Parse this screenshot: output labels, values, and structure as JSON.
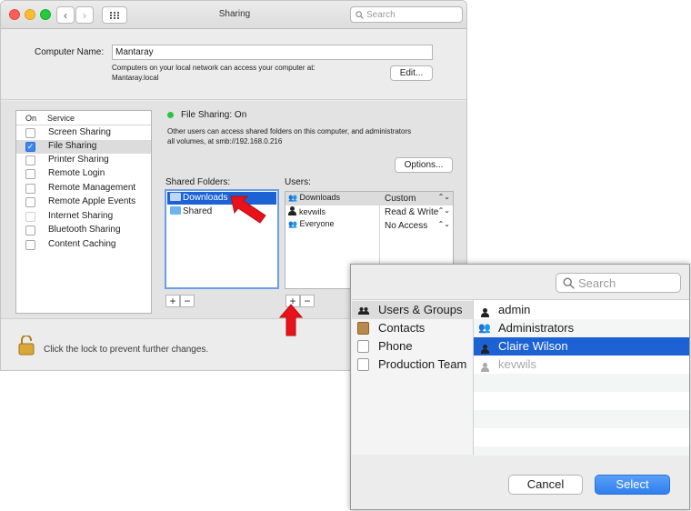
{
  "window": {
    "title": "Sharing",
    "search_placeholder": "Search",
    "computer_name_label": "Computer Name:",
    "computer_name_value": "Mantaray",
    "network_note_1": "Computers on your local network can access your computer at:",
    "network_note_2": "Mantaray.local",
    "edit_button": "Edit...",
    "services": {
      "col_on": "On",
      "col_service": "Service",
      "items": [
        {
          "label": "Screen Sharing",
          "checked": false
        },
        {
          "label": "File Sharing",
          "checked": true
        },
        {
          "label": "Printer Sharing",
          "checked": false
        },
        {
          "label": "Remote Login",
          "checked": false
        },
        {
          "label": "Remote Management",
          "checked": false
        },
        {
          "label": "Remote Apple Events",
          "checked": false
        },
        {
          "label": "Internet Sharing",
          "checked": false
        },
        {
          "label": "Bluetooth Sharing",
          "checked": false
        },
        {
          "label": "Content Caching",
          "checked": false
        }
      ]
    },
    "status": "File Sharing: On",
    "status_color": "#2cc33f",
    "desc_1": "Other users can access shared folders on this computer, and administrators",
    "desc_2": "all volumes, at smb://192.168.0.216",
    "options_button": "Options...",
    "shared_folders_label": "Shared Folders:",
    "shared_folders": [
      "Downloads",
      "Shared"
    ],
    "users_label": "Users:",
    "users": [
      {
        "name": "Downloads",
        "permission": "Custom"
      },
      {
        "name": "kevwils",
        "permission": "Read & Write"
      },
      {
        "name": "Everyone",
        "permission": "No Access"
      }
    ],
    "plus": "+",
    "minus": "−",
    "lock_text": "Click the lock to prevent further changes."
  },
  "dialog": {
    "search_placeholder": "Search",
    "categories": [
      "Users & Groups",
      "Contacts",
      "Phone",
      "Production Team"
    ],
    "selected_category": "Users & Groups",
    "people": [
      {
        "name": "admin",
        "state": "normal"
      },
      {
        "name": "Administrators",
        "state": "normal"
      },
      {
        "name": "Claire Wilson",
        "state": "selected"
      },
      {
        "name": "kevwils",
        "state": "disabled"
      }
    ],
    "cancel_button": "Cancel",
    "select_button": "Select"
  },
  "colors": {
    "accent": "#1d62d4",
    "annotation_arrow": "#e8121b"
  }
}
